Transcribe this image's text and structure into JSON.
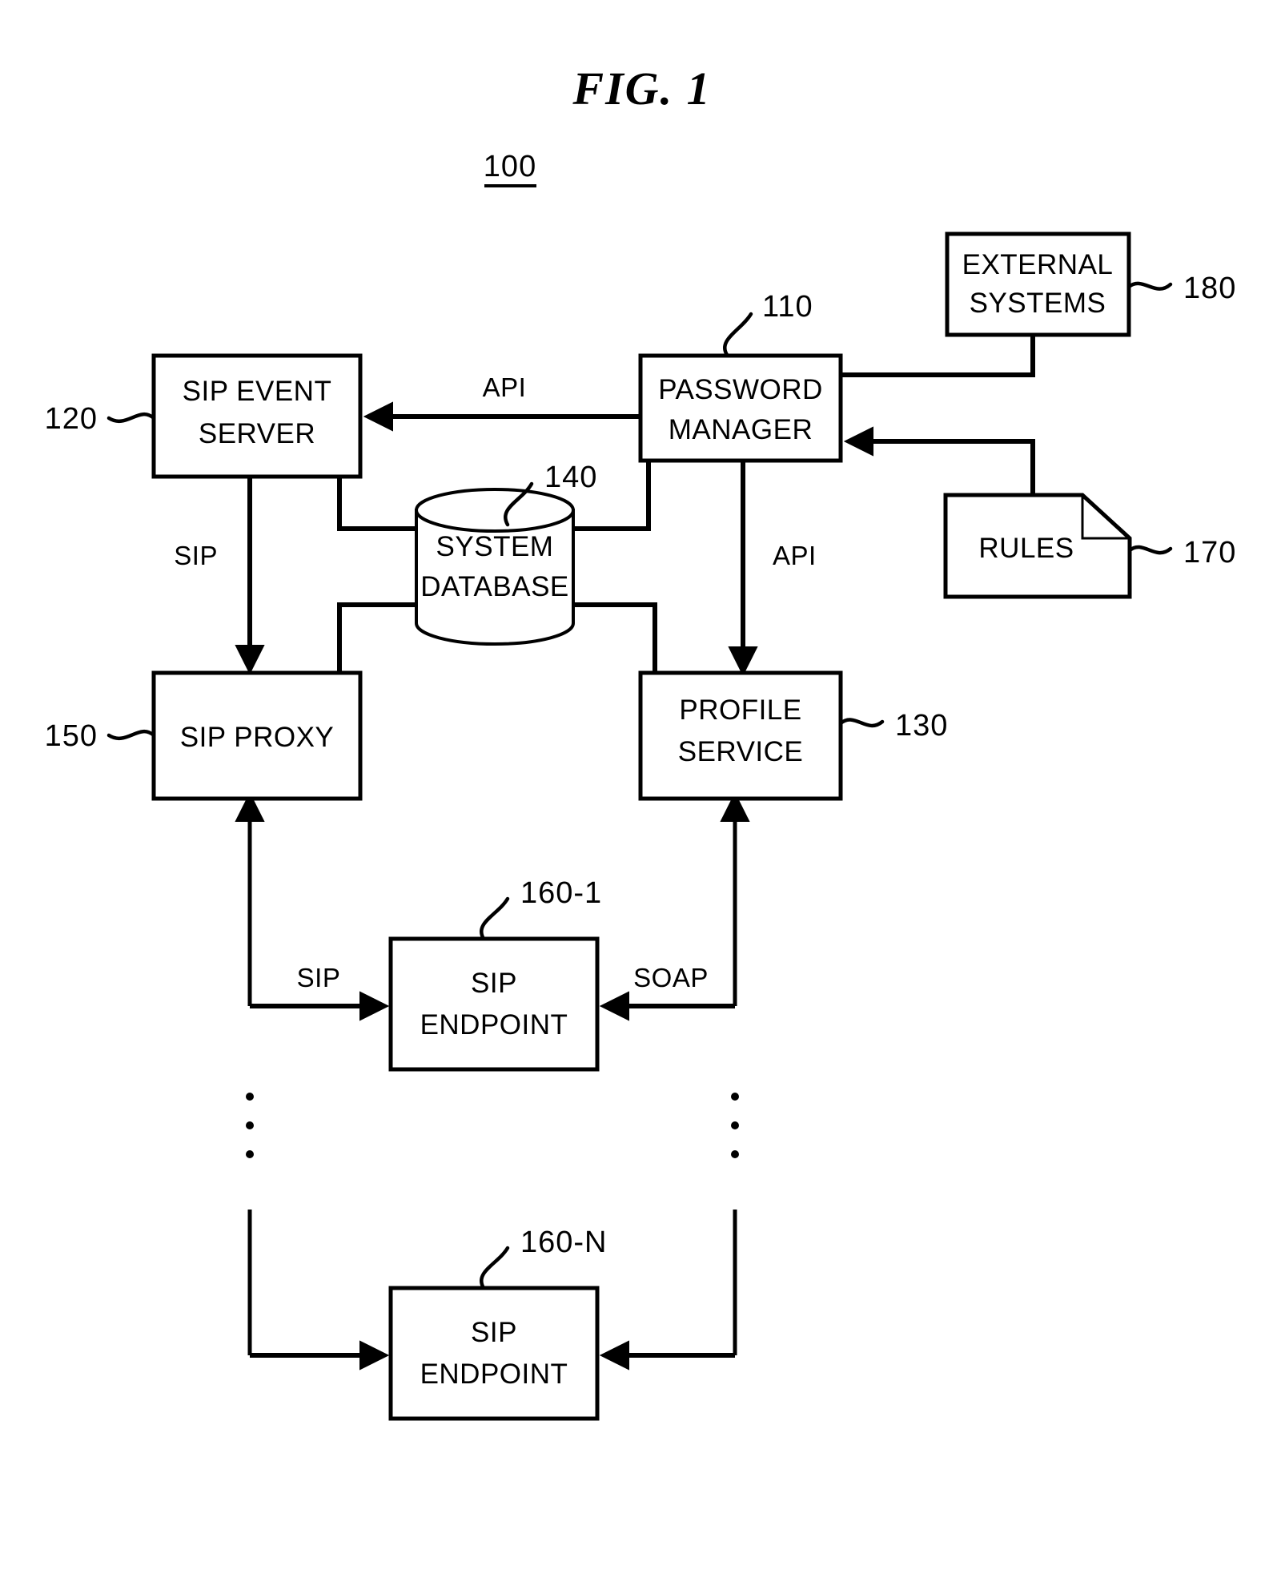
{
  "figure": {
    "title": "FIG.  1",
    "system_number": "100"
  },
  "nodes": [
    {
      "id": "password-manager",
      "label_line1": "PASSWORD",
      "label_line2": "MANAGER",
      "ref": "110",
      "shape": "rect"
    },
    {
      "id": "sip-event-server",
      "label_line1": "SIP  EVENT",
      "label_line2": "SERVER",
      "ref": "120",
      "shape": "rect"
    },
    {
      "id": "profile-service",
      "label_line1": "PROFILE",
      "label_line2": "SERVICE",
      "ref": "130",
      "shape": "rect"
    },
    {
      "id": "system-database",
      "label_line1": "SYSTEM",
      "label_line2": "DATABASE",
      "ref": "140",
      "shape": "cylinder"
    },
    {
      "id": "sip-proxy",
      "label_line1": "SIP  PROXY",
      "label_line2": "",
      "ref": "150",
      "shape": "rect"
    },
    {
      "id": "sip-endpoint-1",
      "label_line1": "SIP",
      "label_line2": "ENDPOINT",
      "ref": "160-1",
      "shape": "rect"
    },
    {
      "id": "sip-endpoint-n",
      "label_line1": "SIP",
      "label_line2": "ENDPOINT",
      "ref": "160-N",
      "shape": "rect"
    },
    {
      "id": "rules",
      "label_line1": "RULES",
      "label_line2": "",
      "ref": "170",
      "shape": "document"
    },
    {
      "id": "external-systems",
      "label_line1": "EXTERNAL",
      "label_line2": "SYSTEMS",
      "ref": "180",
      "shape": "rect"
    }
  ],
  "edge_labels": {
    "api_top": "API",
    "api_right": "API",
    "sip_left": "SIP",
    "sip_endpoint": "SIP",
    "soap_endpoint": "SOAP"
  },
  "ellipsis": {
    "glyph": "·",
    "count": 3
  },
  "colors": {
    "ink": "#000000",
    "paper": "#ffffff"
  }
}
